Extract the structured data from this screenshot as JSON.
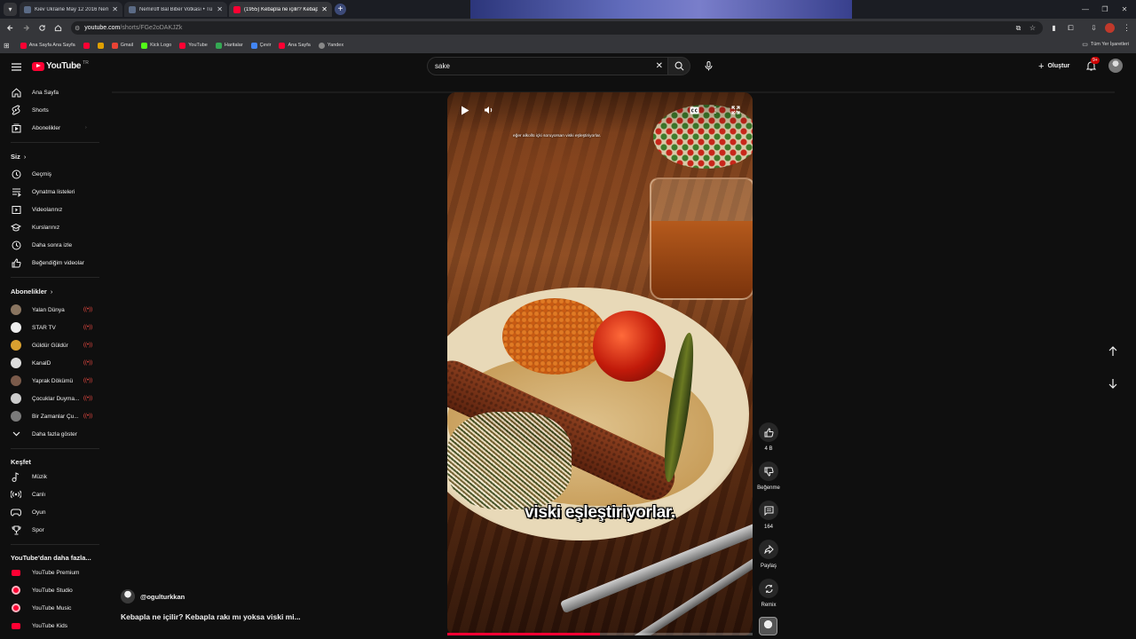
{
  "browser": {
    "tabs": [
      {
        "label": "Kiev Ukraine May 12 2016 Nem",
        "active": false
      },
      {
        "label": "Nemiroff Bal Biber Votkası • Tü",
        "active": false
      },
      {
        "label": "(1955) Kebapla ne içilir? Kebap",
        "active": true
      }
    ],
    "url_host": "youtube.com",
    "url_path": "/shorts/FGe2oDAKJZk",
    "bookmarks": [
      {
        "label": "Ana Sayfa Ana Sayfa",
        "color": "#ff0033"
      },
      {
        "label": "",
        "color": "#ff0033"
      },
      {
        "label": "",
        "color": "#e0a000"
      },
      {
        "label": "Gmail",
        "color": "#ea4335"
      },
      {
        "label": "Kick Logo",
        "color": "#53fc18"
      },
      {
        "label": "YouTube",
        "color": "#ff0033"
      },
      {
        "label": "Haritalar",
        "color": "#34a853"
      },
      {
        "label": "Çevir",
        "color": "#4285f4"
      },
      {
        "label": "Ana Sayfa",
        "color": "#ff0033"
      },
      {
        "label": "Yandex",
        "color": "#888888"
      }
    ],
    "all_bookmarks": "Tüm Yer İşaretleri"
  },
  "header": {
    "logo_text": "YouTube",
    "country": "TR",
    "search_value": "sake",
    "create_label": "Oluştur",
    "notif_badge": "9+"
  },
  "sidebar": {
    "main": [
      {
        "label": "Ana Sayfa",
        "icon": "home-icon"
      },
      {
        "label": "Shorts",
        "icon": "shorts-icon"
      },
      {
        "label": "Abonelikler",
        "icon": "subscriptions-icon"
      }
    ],
    "you_header": "Siz",
    "you": [
      {
        "label": "Geçmiş",
        "icon": "history-icon"
      },
      {
        "label": "Oynatma listeleri",
        "icon": "playlists-icon"
      },
      {
        "label": "Videolarınız",
        "icon": "your-videos-icon"
      },
      {
        "label": "Kurslarınız",
        "icon": "courses-icon"
      },
      {
        "label": "Daha sonra izle",
        "icon": "watch-later-icon"
      },
      {
        "label": "Beğendiğim videolar",
        "icon": "liked-videos-icon"
      }
    ],
    "subs_header": "Abonelikler",
    "subs": [
      {
        "label": "Yalan Dünya",
        "color": "#8a7560"
      },
      {
        "label": "STAR TV",
        "color": "#eeeeee"
      },
      {
        "label": "Güldür Güldür",
        "color": "#d8a030"
      },
      {
        "label": "KanalD",
        "color": "#dddddd"
      },
      {
        "label": "Yaprak Dökümü",
        "color": "#7a5a4a"
      },
      {
        "label": "Çocuklar Duyma...",
        "color": "#cccccc"
      },
      {
        "label": "Bir Zamanlar Çu...",
        "color": "#7a7a7a"
      }
    ],
    "show_more": "Daha fazla göster",
    "explore_header": "Keşfet",
    "explore": [
      {
        "label": "Müzik",
        "icon": "music-icon"
      },
      {
        "label": "Canlı",
        "icon": "live-icon"
      },
      {
        "label": "Oyun",
        "icon": "gaming-icon"
      },
      {
        "label": "Spor",
        "icon": "sports-icon"
      }
    ],
    "more_header": "YouTube'dan daha fazla...",
    "more": [
      {
        "label": "YouTube Premium"
      },
      {
        "label": "YouTube Studio"
      },
      {
        "label": "YouTube Music"
      },
      {
        "label": "YouTube Kids"
      }
    ]
  },
  "short": {
    "top_caption": "eğer alkollü içki soruyorsan viski eşleştiriyorlar.",
    "subtitle": "viski eşleştiriyorlar.",
    "channel": "@ogulturkkan",
    "title": "Kebapla ne içilir? Kebapla rakı mı yoksa viski mi...",
    "progress_fraction": 0.5
  },
  "actions": {
    "like_count": "4 B",
    "dislike_label": "Beğenme",
    "comment_count": "164",
    "share_label": "Paylaş",
    "remix_label": "Remix"
  },
  "colors": {
    "youtube_red": "#ff0033",
    "background": "#0f0f0f",
    "live_red": "#ff4e45"
  }
}
